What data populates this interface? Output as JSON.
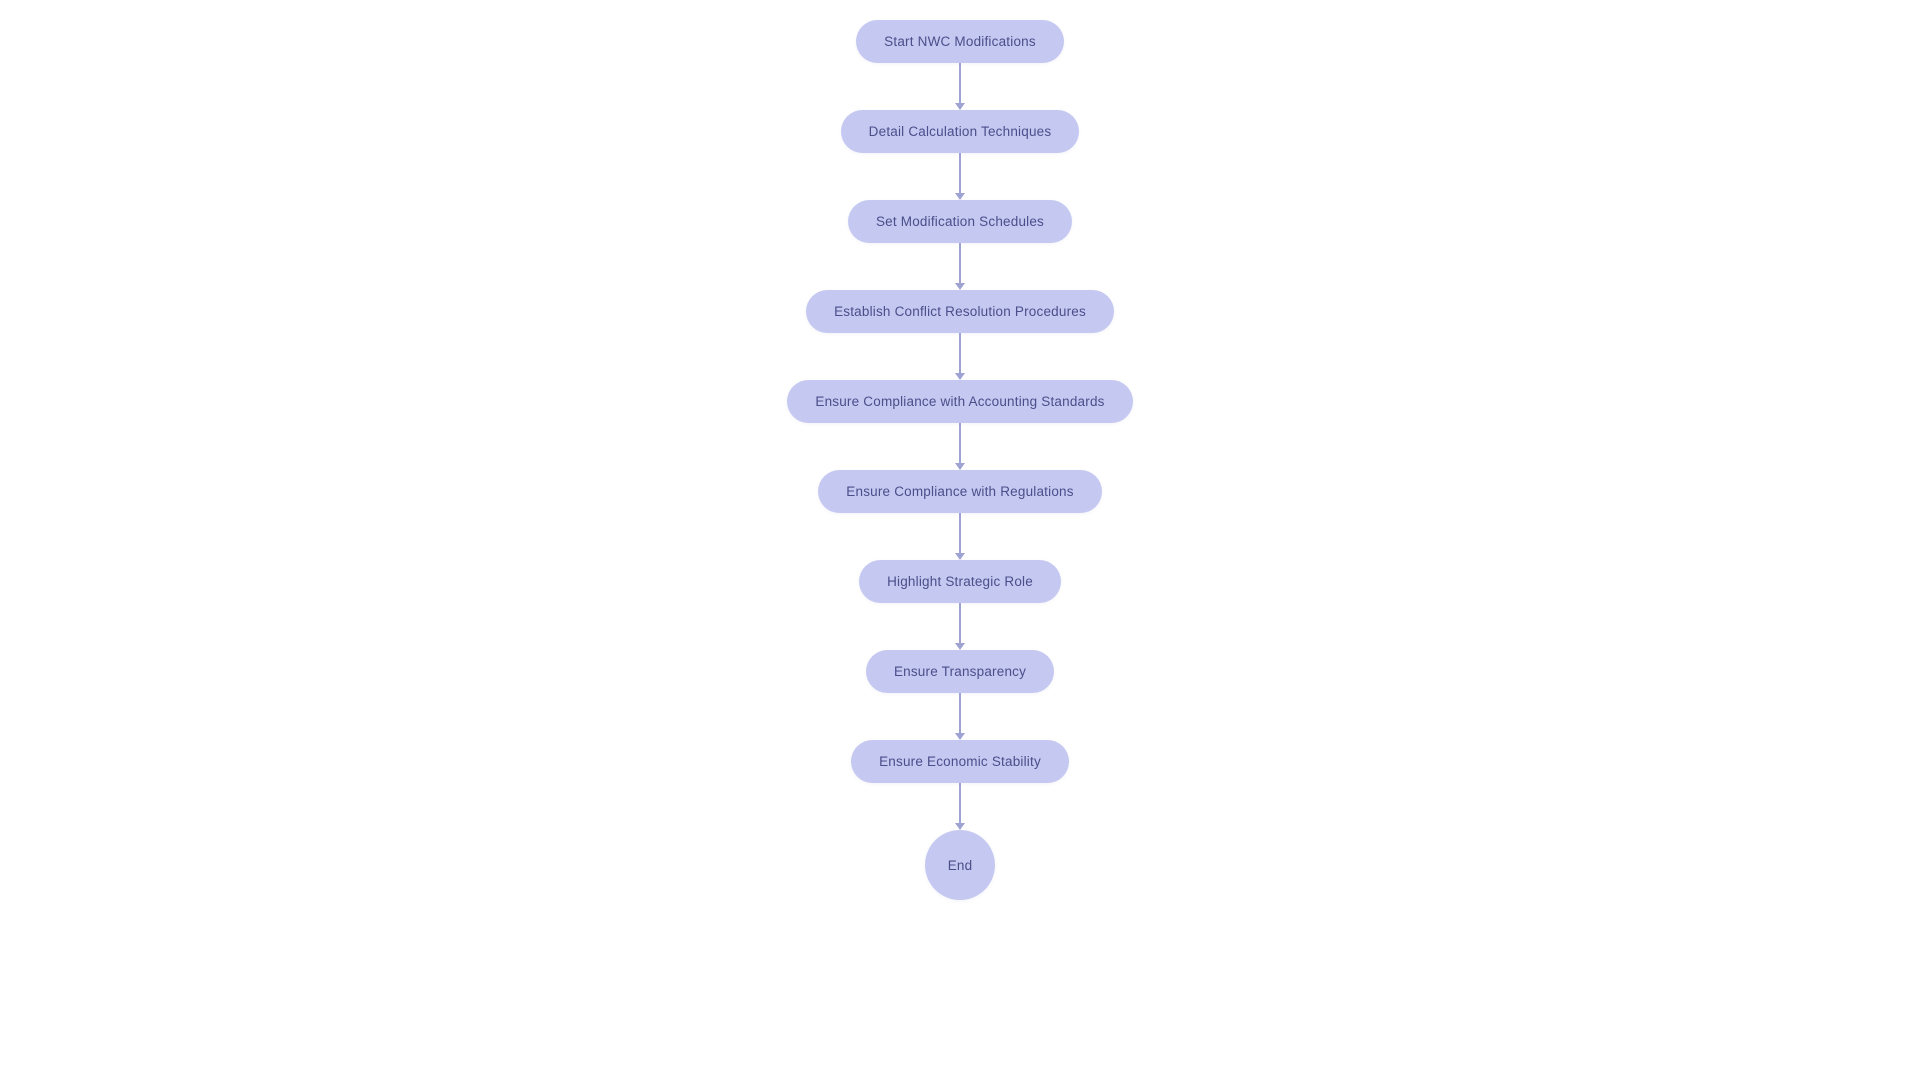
{
  "flowchart": {
    "nodes": [
      {
        "id": "start-nwc",
        "label": "Start NWC Modifications",
        "type": "normal"
      },
      {
        "id": "detail-calc",
        "label": "Detail Calculation Techniques",
        "type": "normal"
      },
      {
        "id": "set-mod",
        "label": "Set Modification Schedules",
        "type": "normal"
      },
      {
        "id": "establish-conflict",
        "label": "Establish Conflict Resolution Procedures",
        "type": "wide"
      },
      {
        "id": "ensure-accounting",
        "label": "Ensure Compliance with Accounting Standards",
        "type": "wide"
      },
      {
        "id": "ensure-regulations",
        "label": "Ensure Compliance with Regulations",
        "type": "normal"
      },
      {
        "id": "highlight-strategic",
        "label": "Highlight Strategic Role",
        "type": "normal"
      },
      {
        "id": "ensure-transparency",
        "label": "Ensure Transparency",
        "type": "normal"
      },
      {
        "id": "ensure-economic",
        "label": "Ensure Economic Stability",
        "type": "normal"
      },
      {
        "id": "end",
        "label": "End",
        "type": "end"
      }
    ]
  }
}
